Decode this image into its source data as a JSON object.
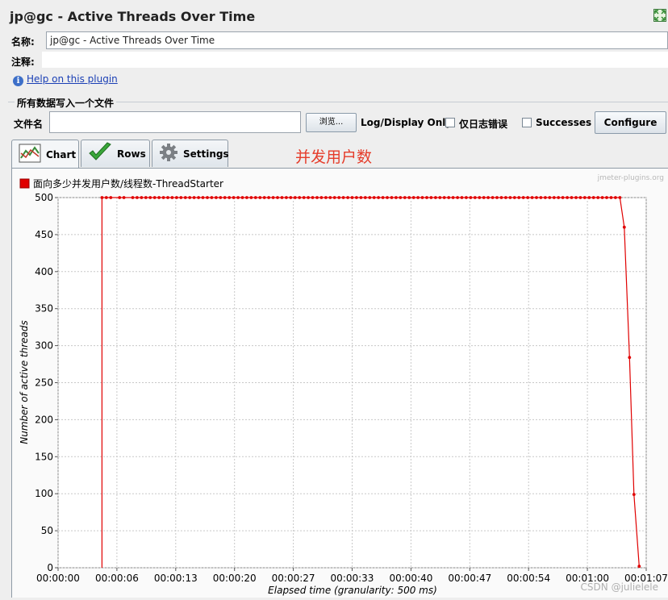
{
  "window": {
    "title": "jp@gc - Active Threads Over Time"
  },
  "form": {
    "name_label": "名称:",
    "name_value": "jp@gc - Active Threads Over Time",
    "comment_label": "注释:",
    "comment_value": "",
    "help_link": "Help on this plugin"
  },
  "file_section": {
    "heading": "所有数据写入一个文件",
    "filename_label": "文件名",
    "filename_value": "",
    "browse_label": "浏览...",
    "log_display_label": "Log/Display Only:",
    "errors_label": "仅日志错误",
    "errors_checked": false,
    "successes_label": "Successes",
    "successes_checked": false,
    "configure_label": "Configure"
  },
  "tabs": [
    {
      "label": "Chart",
      "icon": "chart-icon",
      "active": true
    },
    {
      "label": "Rows",
      "icon": "checkmark-icon",
      "active": false
    },
    {
      "label": "Settings",
      "icon": "gear-icon",
      "active": false
    }
  ],
  "annotation": "并发用户数",
  "brand": "jmeter-plugins.org",
  "watermark": "CSDN @julielele",
  "colors": {
    "series": "#e00000",
    "annotation": "#e53c2a",
    "link": "#1a3fb5"
  },
  "chart_data": {
    "type": "line",
    "xlabel": "Elapsed time (granularity: 500 ms)",
    "ylabel": "Number of active threads",
    "xlim_seconds": [
      0,
      67
    ],
    "ylim": [
      0,
      500
    ],
    "x_tick_labels": [
      "00:00:00",
      "00:00:06",
      "00:00:13",
      "00:00:20",
      "00:00:27",
      "00:00:33",
      "00:00:40",
      "00:00:47",
      "00:00:54",
      "00:01:00",
      "00:01:07"
    ],
    "y_ticks": [
      0,
      50,
      100,
      150,
      200,
      250,
      300,
      350,
      400,
      450,
      500
    ],
    "grid": true,
    "legend_position": "top-left",
    "series": [
      {
        "name": "面向多少并发用户数/线程数-ThreadStarter",
        "color": "#e00000",
        "ramp_up": {
          "x": 5.0,
          "from": 0,
          "to": 500
        },
        "steady": {
          "x_start": 5.0,
          "x_end": 64.0,
          "step": 0.5,
          "value": 500,
          "missing_x": [
            6.5,
            8.0
          ]
        },
        "ramp_down": [
          [
            64.0,
            500
          ],
          [
            64.5,
            460
          ],
          [
            65.1,
            284
          ],
          [
            65.6,
            99
          ],
          [
            66.2,
            2
          ]
        ]
      }
    ]
  }
}
